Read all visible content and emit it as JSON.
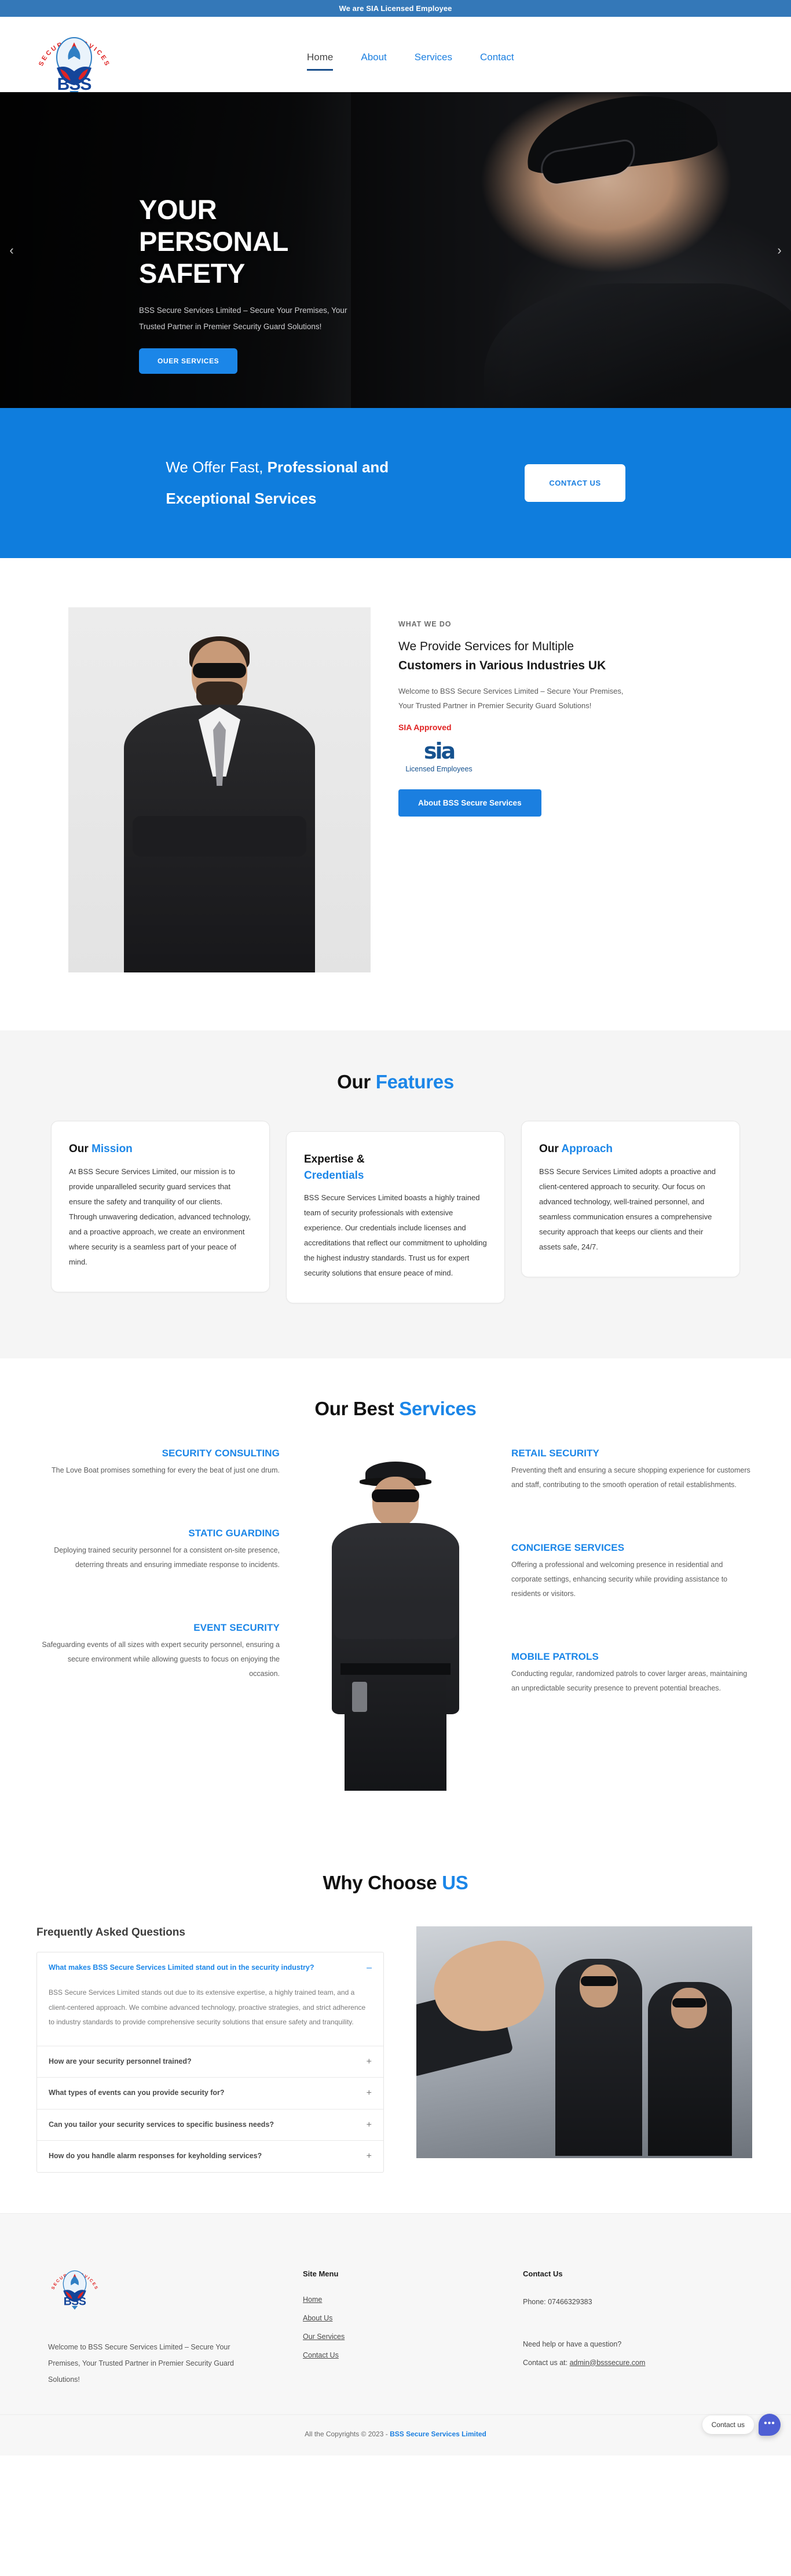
{
  "topbar": {
    "text": "We are SIA Licensed Employee"
  },
  "header": {
    "logo_alt": "BSS Secure Services Limited",
    "nav": [
      {
        "label": "Home",
        "active": true
      },
      {
        "label": "About",
        "active": false
      },
      {
        "label": "Services",
        "active": false
      },
      {
        "label": "Contact",
        "active": false
      }
    ]
  },
  "hero": {
    "line1": "YOUR",
    "line2": "PERSONAL",
    "line3": "SAFETY",
    "subtitle": "BSS Secure Services Limited – Secure Your Premises, Your Trusted Partner in Premier Security Guard Solutions!",
    "cta": "OUER SERVICES",
    "prev_arrow": "‹",
    "next_arrow": "›"
  },
  "offer": {
    "text_normal": "We Offer Fast, ",
    "text_bold": "Professional and Exceptional Services",
    "button": "CONTACT US"
  },
  "whatwedo": {
    "eyebrow": "WHAT WE DO",
    "heading_light": "We Provide Services for Multiple",
    "heading_bold": "Customers in Various Industries UK",
    "paragraph": "Welcome to BSS Secure Services Limited – Secure Your Premises, Your Trusted Partner in Premier Security Guard Solutions!",
    "sia_label": "SIA Approved",
    "sia_mark": "sia",
    "sia_caption": "Licensed Employees",
    "button": "About BSS Secure Services"
  },
  "features": {
    "title_dark": "Our ",
    "title_accent": "Features",
    "cards": [
      {
        "title_dark": "Our ",
        "title_accent": "Mission",
        "body": "At BSS Secure Services Limited, our mission is to provide unparalleled security guard services that ensure the safety and tranquility of our clients. Through unwavering dedication, advanced technology, and a proactive approach, we create an environment where security is a seamless part of your peace of mind."
      },
      {
        "title_dark": "Expertise & ",
        "title_accent": "Credentials",
        "body": "BSS Secure Services Limited boasts a highly trained team of security professionals with extensive experience. Our credentials include licenses and accreditations that reflect our commitment to upholding the highest industry standards. Trust us for expert security solutions that ensure peace of mind."
      },
      {
        "title_dark": "Our ",
        "title_accent": "Approach",
        "body": "BSS Secure Services Limited adopts a proactive and client-centered approach to security. Our focus on advanced technology, well-trained personnel, and seamless communication ensures a comprehensive security approach that keeps our clients and their assets safe, 24/7."
      }
    ]
  },
  "bestservices": {
    "title_dark": "Our Best ",
    "title_accent": "Services",
    "left": [
      {
        "title": "SECURITY CONSULTING",
        "body": "The Love Boat promises something for every the beat of just one drum."
      },
      {
        "title": "STATIC GUARDING",
        "body": "Deploying trained security personnel for a consistent on-site presence, deterring threats and ensuring immediate response to incidents."
      },
      {
        "title": "EVENT SECURITY",
        "body": "Safeguarding events of all sizes with expert security personnel, ensuring a secure environment while allowing guests to focus on enjoying the occasion."
      }
    ],
    "right": [
      {
        "title": "RETAIL SECURITY",
        "body": "Preventing theft and ensuring a secure shopping experience for customers and staff, contributing to the smooth operation of retail establishments."
      },
      {
        "title": "CONCIERGE SERVICES",
        "body": "Offering a professional and welcoming presence in residential and corporate settings, enhancing security while providing assistance to residents or visitors."
      },
      {
        "title": "MOBILE PATROLS",
        "body": "Conducting regular, randomized patrols to cover larger areas, maintaining an unpredictable security presence to prevent potential breaches."
      }
    ]
  },
  "whychoose": {
    "title_dark": "Why Choose ",
    "title_accent": "US"
  },
  "faq": {
    "title": "Frequently Asked Questions",
    "items": [
      {
        "question": "What makes BSS Secure Services Limited stand out in the security industry?",
        "answer": "BSS Secure Services Limited stands out due to its extensive expertise, a highly trained team, and a client-centered approach. We combine advanced technology, proactive strategies, and strict adherence to industry standards to provide comprehensive security solutions that ensure safety and tranquility.",
        "open": true,
        "sign": "–"
      },
      {
        "question": "How are your security personnel trained?",
        "answer": "",
        "open": false,
        "sign": "+"
      },
      {
        "question": "What types of events can you provide security for?",
        "answer": "",
        "open": false,
        "sign": "+"
      },
      {
        "question": "Can you tailor your security services to specific business needs?",
        "answer": "",
        "open": false,
        "sign": "+"
      },
      {
        "question": "How do you handle alarm responses for keyholding services?",
        "answer": "",
        "open": false,
        "sign": "+"
      }
    ]
  },
  "footer": {
    "about": "Welcome to BSS Secure Services Limited – Secure Your Premises, Your Trusted Partner in Premier Security Guard Solutions!",
    "sitemenu": {
      "heading": "Site Menu",
      "links": [
        {
          "label": "Home"
        },
        {
          "label": "About Us"
        },
        {
          "label": "Our Services"
        },
        {
          "label": "Contact Us"
        }
      ]
    },
    "contact": {
      "heading": "Contact Us",
      "phone": "Phone: 07466329383",
      "help": "Need help or have a question?",
      "email_prefix": "Contact us at: ",
      "email": "admin@bsssecure.com"
    },
    "copyright_prefix": "All the Copyrights © 2023 - ",
    "copyright_brand": "BSS Secure Services Limited"
  },
  "chat": {
    "label": "Contact us",
    "icon": "•••"
  },
  "colors": {
    "brand_blue": "#1b7fe0",
    "accent_blue": "#1b86e8",
    "band_blue": "#0f7ddd",
    "topbar_blue": "#3478b8",
    "sia_red": "#e02020",
    "chat_purple": "#4e5fd4"
  }
}
